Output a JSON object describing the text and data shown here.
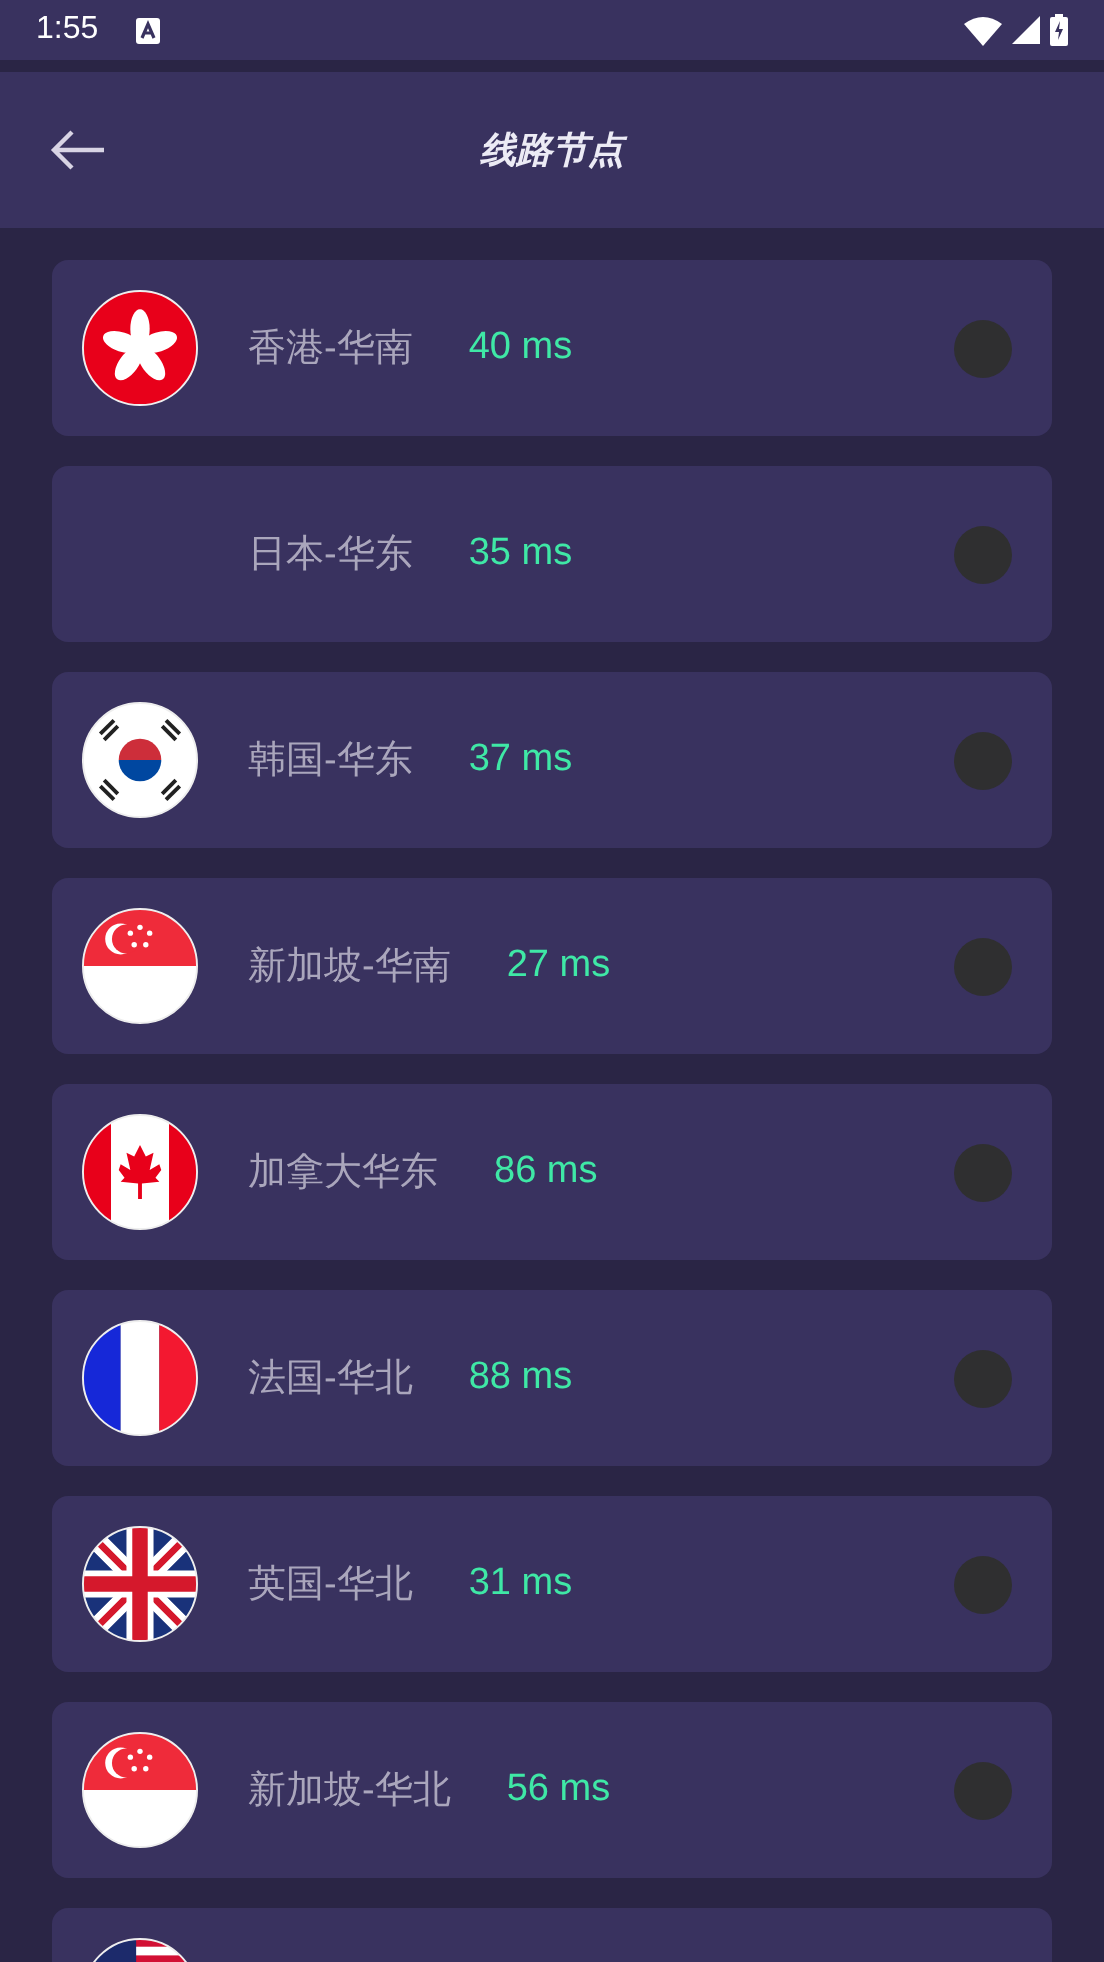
{
  "status_bar": {
    "time": "1:55"
  },
  "header": {
    "title": "线路节点"
  },
  "nodes": [
    {
      "kind": "hk",
      "name": "香港-华南",
      "ping": "40 ms",
      "selected": false
    },
    {
      "kind": "blank",
      "name": "日本-华东",
      "ping": "35 ms",
      "selected": false
    },
    {
      "kind": "kr",
      "name": "韩国-华东",
      "ping": "37 ms",
      "selected": false
    },
    {
      "kind": "sg",
      "name": "新加坡-华南",
      "ping": "27 ms",
      "selected": false
    },
    {
      "kind": "ca",
      "name": "加拿大华东",
      "ping": "86 ms",
      "selected": false
    },
    {
      "kind": "fr",
      "name": "法国-华北",
      "ping": "88 ms",
      "selected": false
    },
    {
      "kind": "gb",
      "name": "英国-华北",
      "ping": "31 ms",
      "selected": false
    },
    {
      "kind": "sg",
      "name": "新加坡-华北",
      "ping": "56 ms",
      "selected": false
    },
    {
      "kind": "us"
    }
  ]
}
